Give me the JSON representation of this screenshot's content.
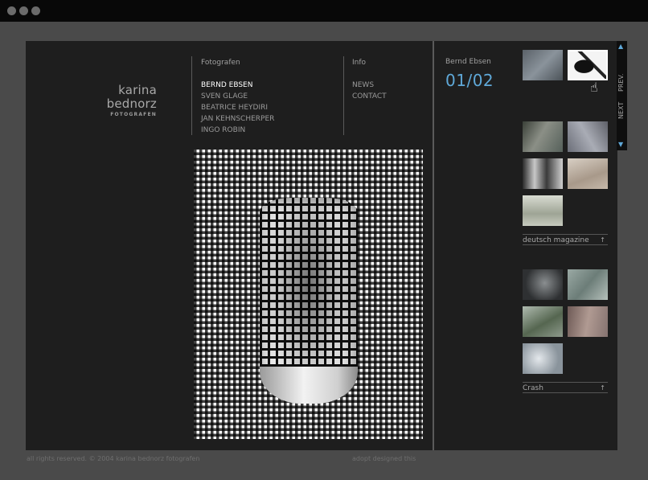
{
  "logo": {
    "name": "karina bednorz",
    "sub": "FOTOGRAFEN"
  },
  "nav": {
    "fotografen_heading": "Fotografen",
    "photographers": [
      "BERND EBSEN",
      "SVEN GLAGE",
      "BEATRICE HEYDIRI",
      "JAN KEHNSCHERPER",
      "INGO ROBIN"
    ],
    "active_photographer": "BERND EBSEN",
    "info_heading": "Info",
    "info_items": [
      "NEWS",
      "CONTACT"
    ]
  },
  "viewer": {
    "photographer_name": "Bernd Ebsen",
    "counter": "01/02"
  },
  "scroll": {
    "prev_label": "PREV.",
    "next_label": "NEXT"
  },
  "categories": [
    {
      "label": "deutsch magazine",
      "arrow": "↑"
    },
    {
      "label": "Crash",
      "arrow": "↑"
    }
  ],
  "footer": {
    "copyright": "all rights reserved. © 2004 karina bednorz fotografen",
    "credit": "adopt designed this"
  },
  "colors": {
    "accent": "#5fa8d8",
    "panel": "#1e1e1e",
    "frame": "#4a4a4a"
  },
  "icons": {
    "cursor": "hand-pointer-icon",
    "scroll_up": "triangle-up-icon",
    "scroll_down": "triangle-down-icon"
  }
}
